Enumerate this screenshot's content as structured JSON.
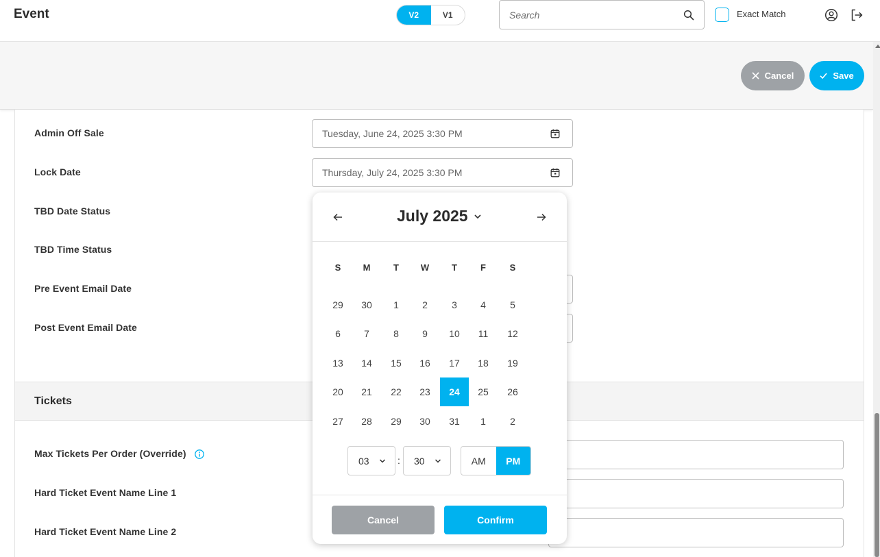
{
  "header": {
    "title": "Event",
    "version_tabs": [
      {
        "label": "V2",
        "active": true
      },
      {
        "label": "V1",
        "active": false
      }
    ],
    "search": {
      "placeholder": "Search",
      "value": ""
    },
    "exact_match": {
      "label": "Exact Match",
      "checked": false
    }
  },
  "actions": {
    "cancel_label": "Cancel",
    "save_label": "Save"
  },
  "form": {
    "fields": [
      {
        "label": "Admin Off Sale",
        "value": "Tuesday, June 24, 2025 3:30 PM"
      },
      {
        "label": "Lock Date",
        "value": "Thursday, July 24, 2025 3:30 PM"
      },
      {
        "label": "TBD Date Status"
      },
      {
        "label": "TBD Time Status"
      },
      {
        "label": "Pre Event Email Date"
      },
      {
        "label": "Post Event Email Date"
      }
    ],
    "tickets_section": {
      "title": "Tickets",
      "fields": [
        {
          "label": "Max Tickets Per Order (Override)"
        },
        {
          "label": "Hard Ticket Event Name Line 1"
        },
        {
          "label": "Hard Ticket Event Name Line 2"
        }
      ]
    }
  },
  "picker": {
    "month_label": "July 2025",
    "weekdays": [
      "S",
      "M",
      "T",
      "W",
      "T",
      "F",
      "S"
    ],
    "weeks": [
      [
        "29",
        "30",
        "1",
        "2",
        "3",
        "4",
        "5"
      ],
      [
        "6",
        "7",
        "8",
        "9",
        "10",
        "11",
        "12"
      ],
      [
        "13",
        "14",
        "15",
        "16",
        "17",
        "18",
        "19"
      ],
      [
        "20",
        "21",
        "22",
        "23",
        "24",
        "25",
        "26"
      ],
      [
        "27",
        "28",
        "29",
        "30",
        "31",
        "1",
        "2"
      ]
    ],
    "selected_day": "24",
    "hour": "03",
    "minute": "30",
    "colon": ":",
    "am_label": "AM",
    "pm_label": "PM",
    "period": "PM",
    "cancel_label": "Cancel",
    "confirm_label": "Confirm"
  },
  "colors": {
    "accent": "#00b2ef",
    "muted_button": "#9ea2a6"
  }
}
